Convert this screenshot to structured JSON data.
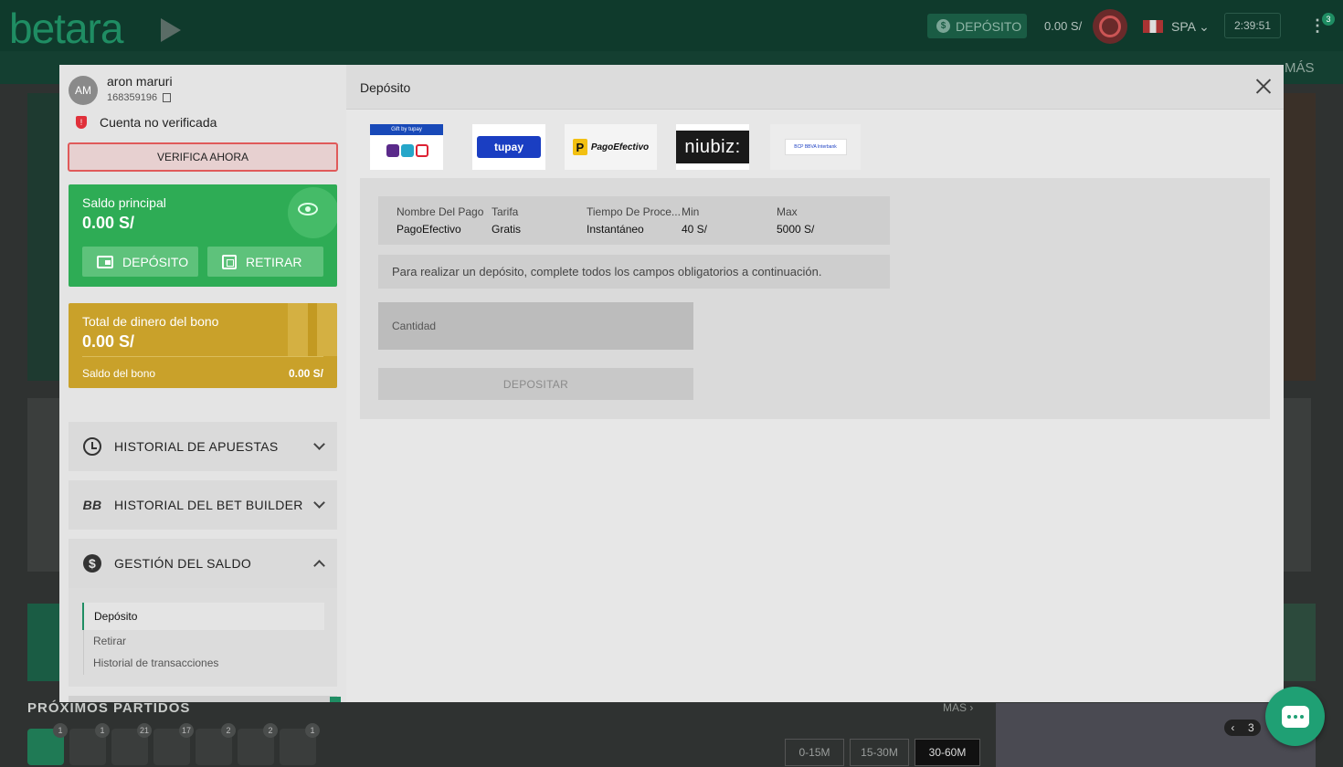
{
  "header": {
    "logo": "betara",
    "deposit_label": "DEPÓSITO",
    "balance": "0.00 S/",
    "language": "SPA",
    "time": "2:39:51",
    "notification_count": "3",
    "nav_more": "MÁS"
  },
  "background": {
    "upcoming_title": "PRÓXIMOS PARTIDOS",
    "more_link": "MAS",
    "sport_counts": [
      "1",
      "1",
      "21",
      "17",
      "2",
      "2",
      "1"
    ],
    "time_filters": [
      "0-15M",
      "15-30M",
      "30-60M"
    ],
    "pager": "3"
  },
  "sidebar": {
    "avatar_initials": "AM",
    "user_name": "aron maruri",
    "user_id": "168359196",
    "verification_status": "Cuenta no verificada",
    "verify_button": "VERIFICA AHORA",
    "main_balance": {
      "label": "Saldo principal",
      "amount": "0.00 S/",
      "deposit_button": "DEPÓSITO",
      "withdraw_button": "RETIRAR"
    },
    "bonus": {
      "label": "Total de dinero del bono",
      "amount": "0.00 S/",
      "sub_label": "Saldo del bono",
      "sub_amount": "0.00 S/"
    },
    "accordion": [
      {
        "label": "HISTORIAL DE APUESTAS"
      },
      {
        "label": "HISTORIAL DEL BET BUILDER"
      },
      {
        "label": "GESTIÓN DEL SALDO"
      }
    ],
    "submenu": [
      "Depósito",
      "Retirar",
      "Historial de transacciones"
    ]
  },
  "main": {
    "title": "Depósito",
    "methods": {
      "pago_top": "Gift by tupay",
      "tupay": "tupay",
      "pagoefectivo": "PagoEfectivo",
      "niubiz": "niubiz:",
      "banks": "BCP BBVA Interbank"
    },
    "table": {
      "headers": [
        "Nombre Del Pago",
        "Tarifa",
        "Tiempo De Proce...",
        "Min",
        "Max"
      ],
      "values": [
        "PagoEfectivo",
        "Gratis",
        "Instantáneo",
        "40 S/",
        "5000 S/"
      ]
    },
    "notice": "Para realizar un depósito, complete todos los campos obligatorios a continuación.",
    "amount_placeholder": "Cantidad",
    "submit_button": "DEPOSITAR"
  }
}
